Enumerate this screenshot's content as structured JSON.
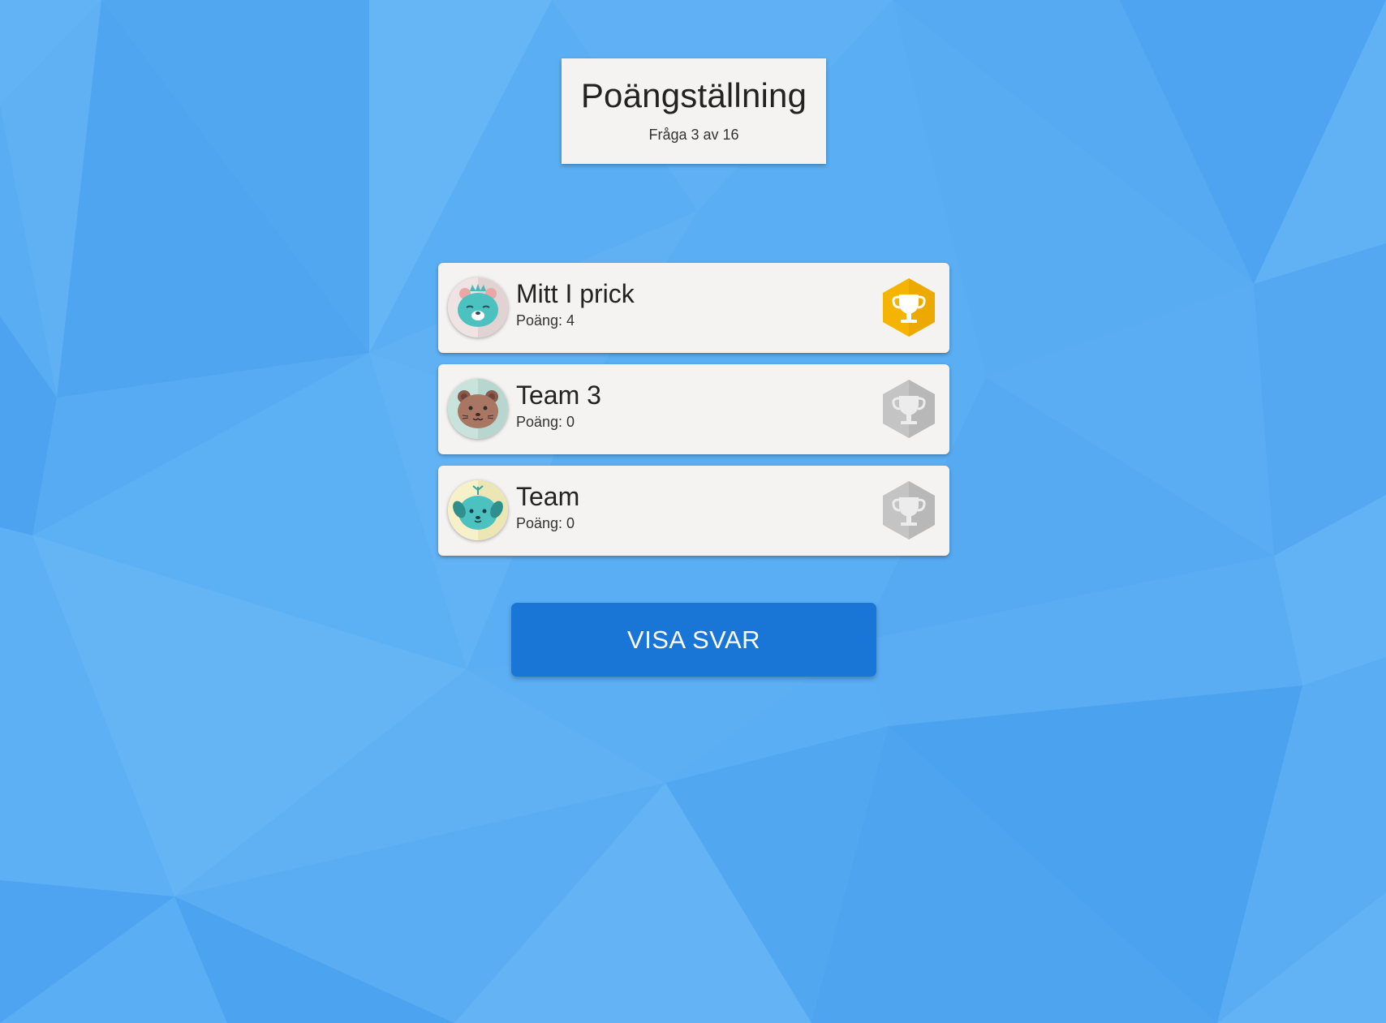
{
  "scoreboard": {
    "title": "Poängställning",
    "question_progress": "Fråga 3 av 16"
  },
  "teams": [
    {
      "name": "Mitt I prick",
      "points": "Poäng: 4",
      "avatar": "teal-bear-icon",
      "trophy": "gold-trophy-icon",
      "trophy_color": "#f5b400"
    },
    {
      "name": "Team 3",
      "points": "Poäng: 0",
      "avatar": "brown-bear-icon",
      "trophy": "grey-trophy-icon",
      "trophy_color": "#bdbdbd"
    },
    {
      "name": "Team",
      "points": "Poäng: 0",
      "avatar": "teal-puppy-icon",
      "trophy": "grey-trophy-icon",
      "trophy_color": "#bdbdbd"
    }
  ],
  "actions": {
    "show_answer_label": "VISA SVAR"
  },
  "colors": {
    "background": "#5aaef3",
    "card": "#f4f3f1",
    "primary_button": "#1976d6",
    "gold": "#f5b400",
    "silver": "#bdbdbd"
  }
}
